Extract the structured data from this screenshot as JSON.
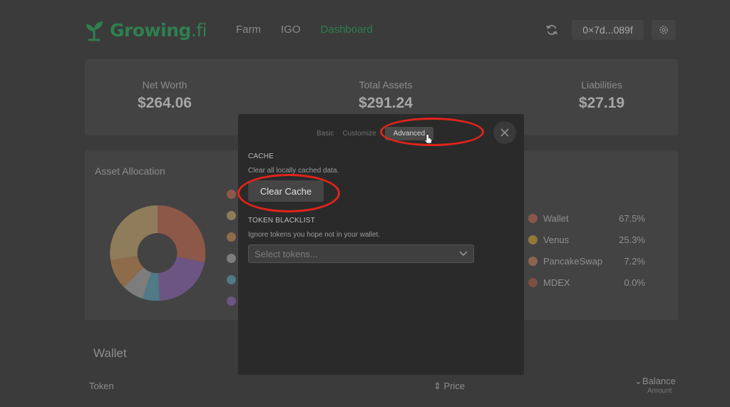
{
  "brand": {
    "name": "Growing",
    "suffix": ".fi"
  },
  "nav": [
    {
      "label": "Farm",
      "active": false
    },
    {
      "label": "IGO",
      "active": false
    },
    {
      "label": "Dashboard",
      "active": true
    }
  ],
  "header": {
    "wallet_address": "0×7d...089f"
  },
  "summary": {
    "net_worth": {
      "label": "Net Worth",
      "value": "$264.06"
    },
    "total_assets": {
      "label": "Total Assets",
      "value": "$291.24"
    },
    "liabilities": {
      "label": "Liabilities",
      "value": "$27.19"
    }
  },
  "allocation": {
    "title": "Asset Allocation",
    "legend": [
      {
        "name": "Wallet",
        "pct": "67.5%",
        "color": "#a0584a"
      },
      {
        "name": "Venus",
        "pct": "25.3%",
        "color": "#a68a3a"
      },
      {
        "name": "PancakeSwap",
        "pct": "7.2%",
        "color": "#a07056"
      },
      {
        "name": "MDEX",
        "pct": "0.0%",
        "color": "#8a5544"
      }
    ]
  },
  "wallet": {
    "title": "Wallet",
    "columns": {
      "token": "Token",
      "price": "Price",
      "balance": "Balance",
      "amount": "Amount"
    }
  },
  "modal": {
    "tabs": [
      {
        "label": "Basic",
        "active": false
      },
      {
        "label": "Customize",
        "active": false
      },
      {
        "label": "Advanced",
        "active": true
      }
    ],
    "cache": {
      "title": "CACHE",
      "description": "Clear all locally cached data.",
      "button": "Clear Cache"
    },
    "blacklist": {
      "title": "TOKEN BLACKLIST",
      "description": "Ignore tokens you hope not in your wallet.",
      "placeholder": "Select tokens..."
    }
  },
  "colors": {
    "brand": "#2f7f4f",
    "annotation": "#e0241b"
  }
}
